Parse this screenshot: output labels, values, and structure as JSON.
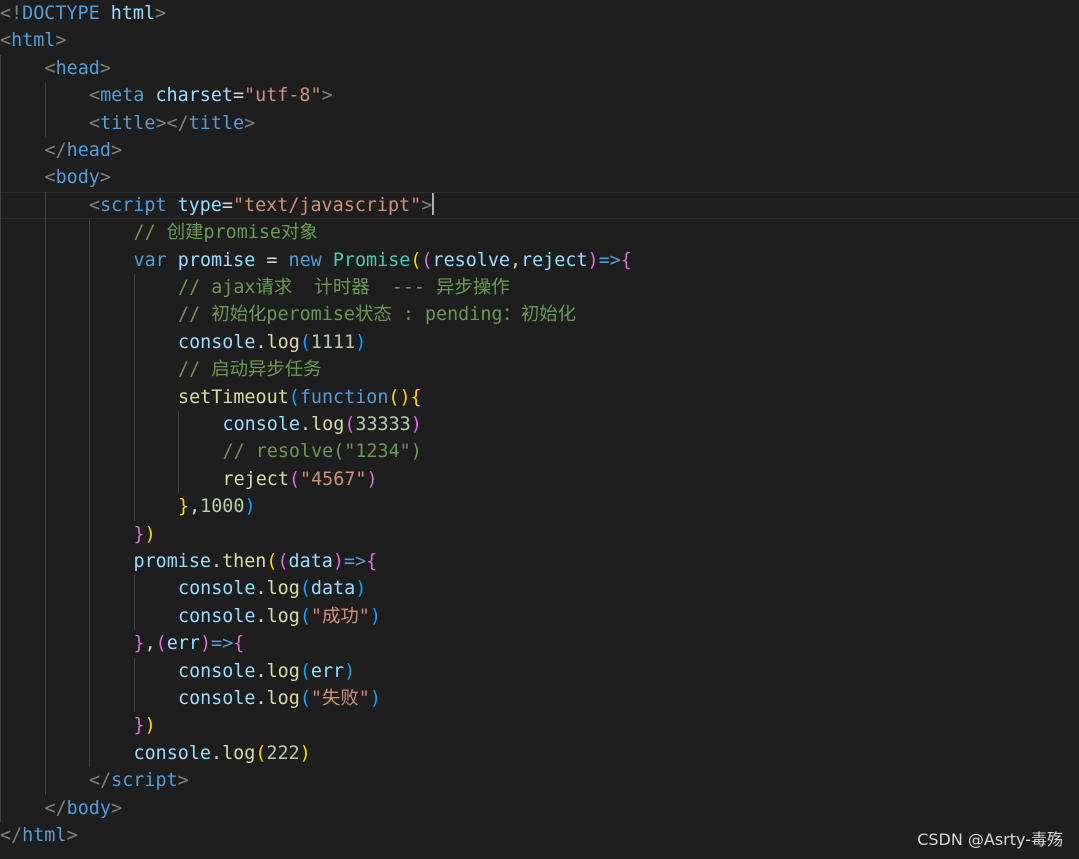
{
  "editor": {
    "cursor_line": 8,
    "lines": [
      {
        "indent": 0,
        "tokens": [
          [
            "<!",
            "#808080"
          ],
          [
            "DOCTYPE",
            "#569cd6"
          ],
          [
            " ",
            "#d4d4d4"
          ],
          [
            "html",
            "#9cdcfe"
          ],
          [
            ">",
            "#808080"
          ]
        ]
      },
      {
        "indent": 0,
        "tokens": [
          [
            "<",
            "#808080"
          ],
          [
            "html",
            "#569cd6"
          ],
          [
            ">",
            "#808080"
          ]
        ]
      },
      {
        "indent": 1,
        "tokens": [
          [
            "<",
            "#808080"
          ],
          [
            "head",
            "#569cd6"
          ],
          [
            ">",
            "#808080"
          ]
        ]
      },
      {
        "indent": 2,
        "tokens": [
          [
            "<",
            "#808080"
          ],
          [
            "meta",
            "#569cd6"
          ],
          [
            " ",
            "#d4d4d4"
          ],
          [
            "charset",
            "#9cdcfe"
          ],
          [
            "=",
            "#d4d4d4"
          ],
          [
            "\"utf-8\"",
            "#ce9178"
          ],
          [
            ">",
            "#808080"
          ]
        ]
      },
      {
        "indent": 2,
        "tokens": [
          [
            "<",
            "#808080"
          ],
          [
            "title",
            "#569cd6"
          ],
          [
            "></",
            "#808080"
          ],
          [
            "title",
            "#569cd6"
          ],
          [
            ">",
            "#808080"
          ]
        ]
      },
      {
        "indent": 1,
        "tokens": [
          [
            "</",
            "#808080"
          ],
          [
            "head",
            "#569cd6"
          ],
          [
            ">",
            "#808080"
          ]
        ]
      },
      {
        "indent": 1,
        "tokens": [
          [
            "<",
            "#808080"
          ],
          [
            "body",
            "#569cd6"
          ],
          [
            ">",
            "#808080"
          ]
        ]
      },
      {
        "indent": 2,
        "tokens": [
          [
            "<",
            "#808080"
          ],
          [
            "script",
            "#569cd6"
          ],
          [
            " ",
            "#d4d4d4"
          ],
          [
            "type",
            "#9cdcfe"
          ],
          [
            "=",
            "#d4d4d4"
          ],
          [
            "\"text/javascript\"",
            "#ce9178"
          ],
          [
            ">",
            "#808080"
          ]
        ]
      },
      {
        "indent": 3,
        "tokens": [
          [
            "// 创建promise对象",
            "#6a9955"
          ]
        ]
      },
      {
        "indent": 3,
        "tokens": [
          [
            "var",
            "#569cd6"
          ],
          [
            " ",
            "#d4d4d4"
          ],
          [
            "promise",
            "#9cdcfe"
          ],
          [
            " = ",
            "#d4d4d4"
          ],
          [
            "new",
            "#569cd6"
          ],
          [
            " ",
            "#d4d4d4"
          ],
          [
            "Promise",
            "#4ec9b0"
          ],
          [
            "(",
            "#ffd700"
          ],
          [
            "(",
            "#da70d6"
          ],
          [
            "resolve",
            "#9cdcfe"
          ],
          [
            ",",
            "#d4d4d4"
          ],
          [
            "reject",
            "#9cdcfe"
          ],
          [
            ")",
            "#da70d6"
          ],
          [
            "=>",
            "#569cd6"
          ],
          [
            "{",
            "#da70d6"
          ]
        ]
      },
      {
        "indent": 4,
        "tokens": [
          [
            "// ajax请求  计时器  --- 异步操作",
            "#6a9955"
          ]
        ]
      },
      {
        "indent": 4,
        "tokens": [
          [
            "// 初始化peromise状态 : pending：初始化",
            "#6a9955"
          ]
        ]
      },
      {
        "indent": 4,
        "tokens": [
          [
            "console",
            "#9cdcfe"
          ],
          [
            ".",
            "#d4d4d4"
          ],
          [
            "log",
            "#dcdcaa"
          ],
          [
            "(",
            "#179fff"
          ],
          [
            "1111",
            "#b5cea8"
          ],
          [
            ")",
            "#179fff"
          ]
        ]
      },
      {
        "indent": 4,
        "tokens": [
          [
            "// 启动异步任务",
            "#6a9955"
          ]
        ]
      },
      {
        "indent": 4,
        "tokens": [
          [
            "setTimeout",
            "#dcdcaa"
          ],
          [
            "(",
            "#179fff"
          ],
          [
            "function",
            "#569cd6"
          ],
          [
            "(",
            "#ffd700"
          ],
          [
            ")",
            "#ffd700"
          ],
          [
            "{",
            "#ffd700"
          ]
        ]
      },
      {
        "indent": 5,
        "tokens": [
          [
            "console",
            "#9cdcfe"
          ],
          [
            ".",
            "#d4d4d4"
          ],
          [
            "log",
            "#dcdcaa"
          ],
          [
            "(",
            "#da70d6"
          ],
          [
            "33333",
            "#b5cea8"
          ],
          [
            ")",
            "#da70d6"
          ]
        ]
      },
      {
        "indent": 5,
        "tokens": [
          [
            "// resolve(\"1234\")",
            "#6a9955"
          ]
        ]
      },
      {
        "indent": 5,
        "tokens": [
          [
            "reject",
            "#dcdcaa"
          ],
          [
            "(",
            "#da70d6"
          ],
          [
            "\"4567\"",
            "#ce9178"
          ],
          [
            ")",
            "#da70d6"
          ]
        ]
      },
      {
        "indent": 4,
        "tokens": [
          [
            "}",
            "#ffd700"
          ],
          [
            ",",
            "#d4d4d4"
          ],
          [
            "1000",
            "#b5cea8"
          ],
          [
            ")",
            "#179fff"
          ]
        ]
      },
      {
        "indent": 3,
        "tokens": [
          [
            "}",
            "#da70d6"
          ],
          [
            ")",
            "#ffd700"
          ]
        ]
      },
      {
        "indent": 3,
        "tokens": [
          [
            "promise",
            "#9cdcfe"
          ],
          [
            ".",
            "#d4d4d4"
          ],
          [
            "then",
            "#dcdcaa"
          ],
          [
            "(",
            "#ffd700"
          ],
          [
            "(",
            "#da70d6"
          ],
          [
            "data",
            "#9cdcfe"
          ],
          [
            ")",
            "#da70d6"
          ],
          [
            "=>",
            "#569cd6"
          ],
          [
            "{",
            "#da70d6"
          ]
        ]
      },
      {
        "indent": 4,
        "tokens": [
          [
            "console",
            "#9cdcfe"
          ],
          [
            ".",
            "#d4d4d4"
          ],
          [
            "log",
            "#dcdcaa"
          ],
          [
            "(",
            "#179fff"
          ],
          [
            "data",
            "#9cdcfe"
          ],
          [
            ")",
            "#179fff"
          ]
        ]
      },
      {
        "indent": 4,
        "tokens": [
          [
            "console",
            "#9cdcfe"
          ],
          [
            ".",
            "#d4d4d4"
          ],
          [
            "log",
            "#dcdcaa"
          ],
          [
            "(",
            "#179fff"
          ],
          [
            "\"成功\"",
            "#ce9178"
          ],
          [
            ")",
            "#179fff"
          ]
        ]
      },
      {
        "indent": 3,
        "tokens": [
          [
            "}",
            "#da70d6"
          ],
          [
            ",",
            "#d4d4d4"
          ],
          [
            "(",
            "#da70d6"
          ],
          [
            "err",
            "#9cdcfe"
          ],
          [
            ")",
            "#da70d6"
          ],
          [
            "=>",
            "#569cd6"
          ],
          [
            "{",
            "#da70d6"
          ]
        ]
      },
      {
        "indent": 4,
        "tokens": [
          [
            "console",
            "#9cdcfe"
          ],
          [
            ".",
            "#d4d4d4"
          ],
          [
            "log",
            "#dcdcaa"
          ],
          [
            "(",
            "#179fff"
          ],
          [
            "err",
            "#9cdcfe"
          ],
          [
            ")",
            "#179fff"
          ]
        ]
      },
      {
        "indent": 4,
        "tokens": [
          [
            "console",
            "#9cdcfe"
          ],
          [
            ".",
            "#d4d4d4"
          ],
          [
            "log",
            "#dcdcaa"
          ],
          [
            "(",
            "#179fff"
          ],
          [
            "\"失败\"",
            "#ce9178"
          ],
          [
            ")",
            "#179fff"
          ]
        ]
      },
      {
        "indent": 3,
        "tokens": [
          [
            "}",
            "#da70d6"
          ],
          [
            ")",
            "#ffd700"
          ]
        ]
      },
      {
        "indent": 3,
        "tokens": [
          [
            "console",
            "#9cdcfe"
          ],
          [
            ".",
            "#d4d4d4"
          ],
          [
            "log",
            "#dcdcaa"
          ],
          [
            "(",
            "#ffd700"
          ],
          [
            "222",
            "#b5cea8"
          ],
          [
            ")",
            "#ffd700"
          ]
        ]
      },
      {
        "indent": 2,
        "tokens": [
          [
            "</",
            "#808080"
          ],
          [
            "script",
            "#569cd6"
          ],
          [
            ">",
            "#808080"
          ]
        ]
      },
      {
        "indent": 1,
        "tokens": [
          [
            "</",
            "#808080"
          ],
          [
            "body",
            "#569cd6"
          ],
          [
            ">",
            "#808080"
          ]
        ]
      },
      {
        "indent": 0,
        "tokens": [
          [
            "</",
            "#808080"
          ],
          [
            "html",
            "#569cd6"
          ],
          [
            ">",
            "#808080"
          ]
        ]
      }
    ]
  },
  "watermark": {
    "text": "CSDN @Asrty-毒殇"
  }
}
